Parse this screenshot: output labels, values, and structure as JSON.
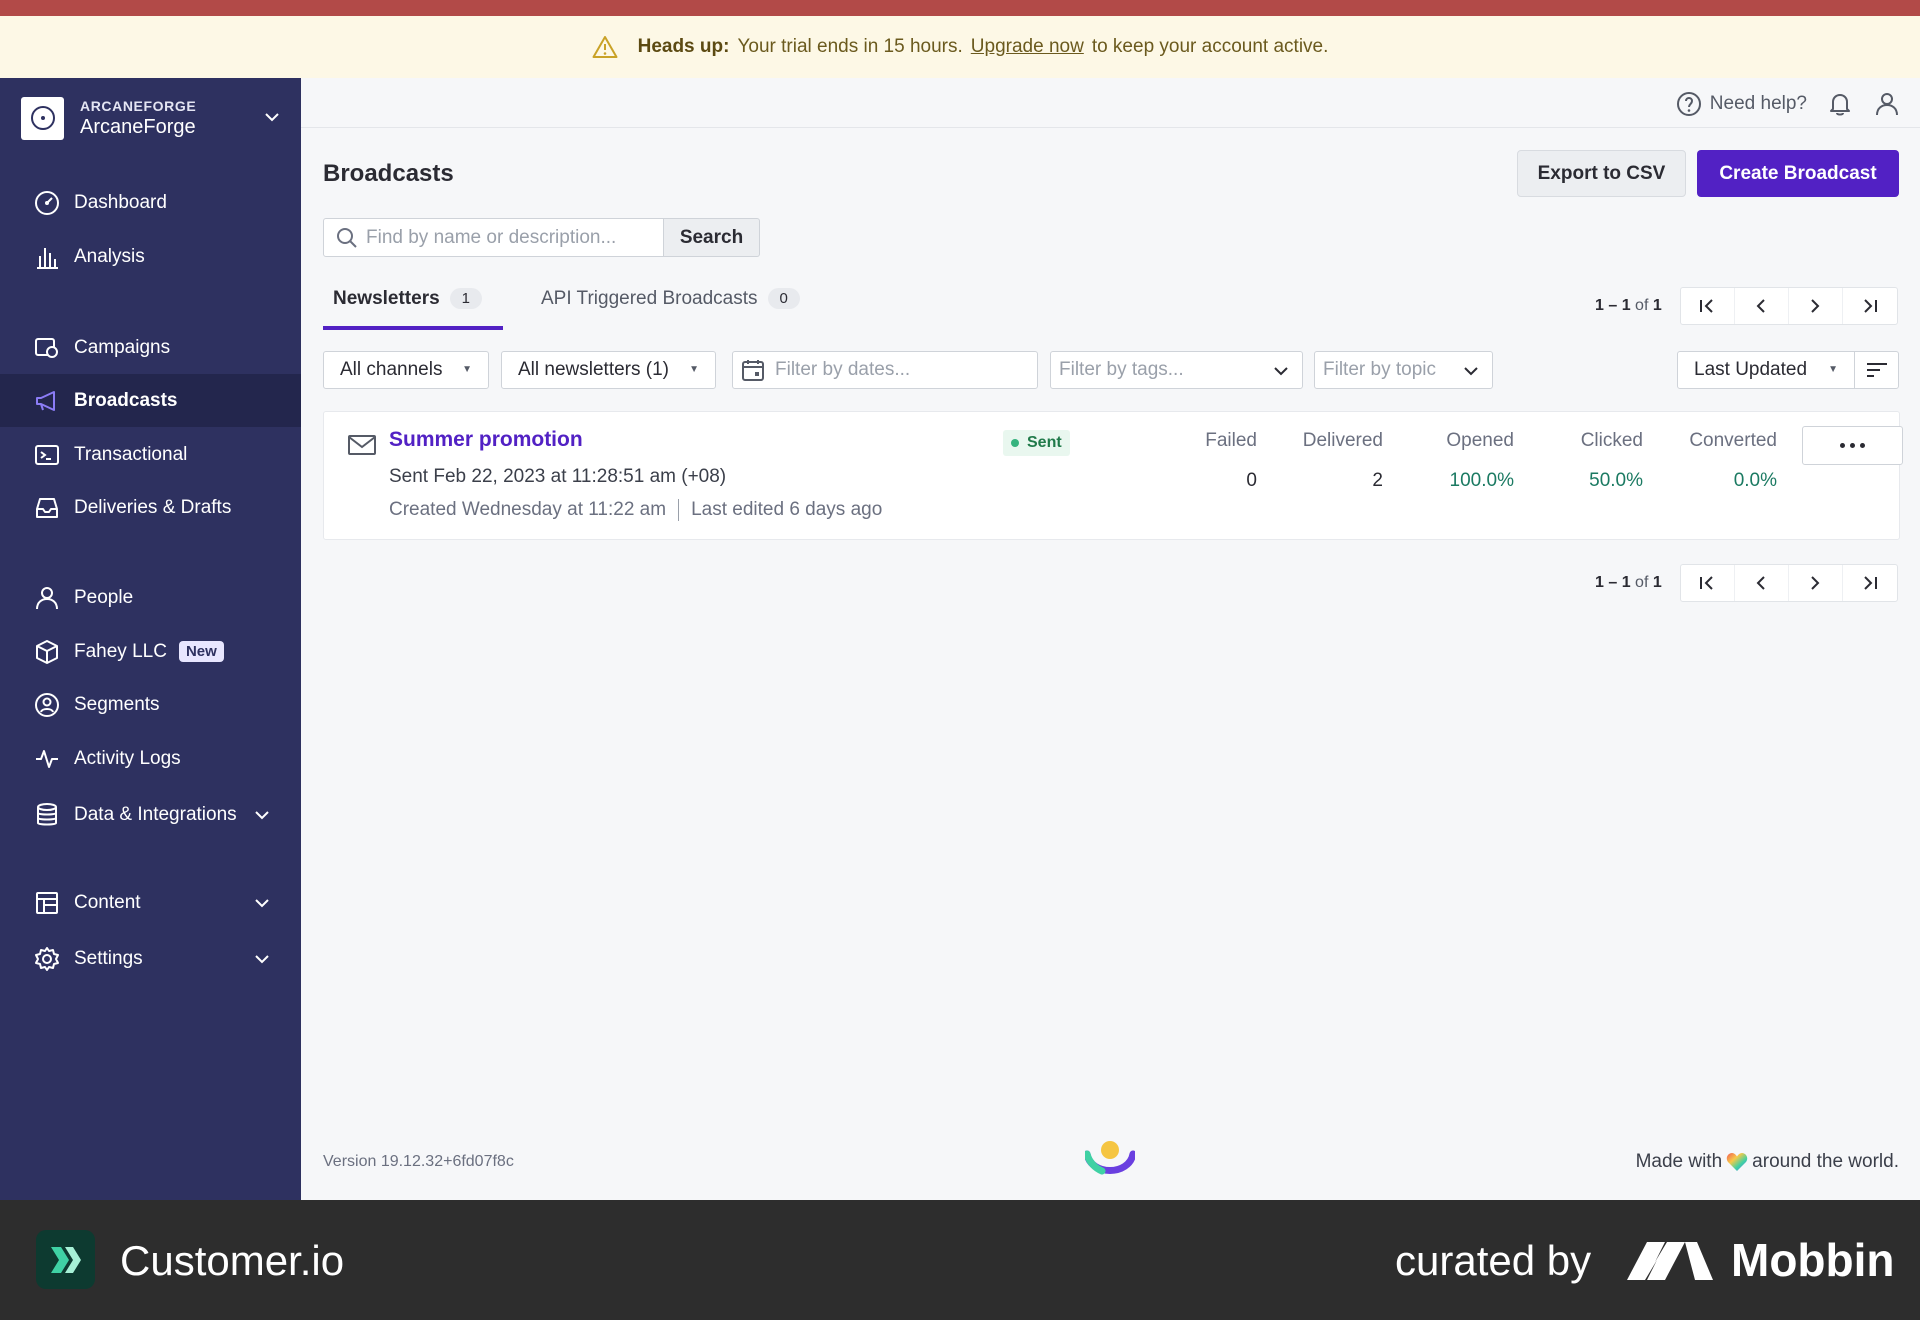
{
  "banner": {
    "bold": "Heads up:",
    "text_before": "Your trial ends in 15 hours.",
    "link": "Upgrade now",
    "text_after": "to keep your account active."
  },
  "sidebar": {
    "org": "ARCANEFORGE",
    "workspace": "ArcaneForge",
    "items": [
      {
        "label": "Dashboard",
        "icon": "dashboard-icon"
      },
      {
        "label": "Analysis",
        "icon": "bar-chart-icon"
      },
      {
        "label": "Campaigns",
        "icon": "campaigns-icon"
      },
      {
        "label": "Broadcasts",
        "icon": "megaphone-icon",
        "active": true
      },
      {
        "label": "Transactional",
        "icon": "terminal-icon"
      },
      {
        "label": "Deliveries & Drafts",
        "icon": "inbox-icon"
      },
      {
        "label": "People",
        "icon": "person-icon"
      },
      {
        "label": "Fahey LLC",
        "icon": "box-icon",
        "badge": "New"
      },
      {
        "label": "Segments",
        "icon": "segments-icon"
      },
      {
        "label": "Activity Logs",
        "icon": "pulse-icon"
      },
      {
        "label": "Data & Integrations",
        "icon": "database-icon"
      },
      {
        "label": "Content",
        "icon": "layout-icon"
      },
      {
        "label": "Settings",
        "icon": "gear-icon"
      }
    ]
  },
  "header": {
    "help": "Need help?"
  },
  "page": {
    "title": "Broadcasts",
    "export_label": "Export to CSV",
    "create_label": "Create Broadcast",
    "search_placeholder": "Find by name or description...",
    "search_button": "Search"
  },
  "tabs": [
    {
      "label": "Newsletters",
      "count": "1"
    },
    {
      "label": "API Triggered Broadcasts",
      "count": "0"
    }
  ],
  "pagination": {
    "range": "1 – 1",
    "of": "of",
    "total": "1"
  },
  "filters": {
    "channels": "All channels",
    "newsletters": "All newsletters (1)",
    "dates_placeholder": "Filter by dates...",
    "tags_placeholder": "Filter by tags...",
    "topic_placeholder": "Filter by topic",
    "sort": "Last Updated"
  },
  "broadcast": {
    "name": "Summer promotion",
    "status": "Sent",
    "sent_line": "Sent Feb 22, 2023 at 11:28:51 am (+08)",
    "created": "Created Wednesday at 11:22 am",
    "edited": "Last edited 6 days ago",
    "metrics": [
      {
        "label": "Failed",
        "value": "0"
      },
      {
        "label": "Delivered",
        "value": "2"
      },
      {
        "label": "Opened",
        "value": "100.0%"
      },
      {
        "label": "Clicked",
        "value": "50.0%"
      },
      {
        "label": "Converted",
        "value": "0.0%"
      }
    ]
  },
  "footer": {
    "version": "Version 19.12.32+6fd07f8c",
    "made_before": "Made with",
    "made_after": "around the world."
  },
  "credit": {
    "brand": "Customer.io",
    "curated": "curated by",
    "mobbin": "Mobbin"
  },
  "colors": {
    "accent": "#5221c4",
    "sidebar": "#2e3160",
    "banner_bg": "#fdf8e6",
    "success": "#1b7a62"
  }
}
